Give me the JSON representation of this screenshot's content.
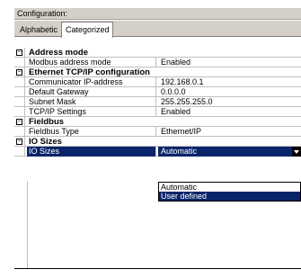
{
  "window": {
    "title": "Configuration:"
  },
  "tabs": [
    {
      "label": "Alphabetic"
    },
    {
      "label": "Categorized"
    }
  ],
  "grid": {
    "rows": [
      {
        "type": "category",
        "toggle": "⊟",
        "label": "Address mode"
      },
      {
        "type": "prop",
        "name": "Modbus address mode",
        "value": "Enabled"
      },
      {
        "type": "category",
        "toggle": "⊟",
        "label": "Ethernet TCP/IP configuration"
      },
      {
        "type": "prop",
        "name": "Communicator IP-address",
        "value": "192.168.0.1"
      },
      {
        "type": "prop",
        "name": "Default Gateway",
        "value": "0.0.0.0"
      },
      {
        "type": "prop",
        "name": "Subnet Mask",
        "value": "255.255.255.0"
      },
      {
        "type": "prop",
        "name": "TCP/IP Settings",
        "value": "Enabled"
      },
      {
        "type": "category",
        "toggle": "⊟",
        "label": "Fieldbus"
      },
      {
        "type": "prop",
        "name": "Fieldbus Type",
        "value": "Ethernet/IP"
      },
      {
        "type": "category",
        "toggle": "⊟",
        "label": "IO Sizes"
      },
      {
        "type": "prop",
        "name": "IO Sizes",
        "value": "Automatic",
        "selected": true
      }
    ]
  },
  "dropdown": {
    "options": [
      "Automatic",
      "User defined"
    ],
    "highlighted_index": 1
  }
}
